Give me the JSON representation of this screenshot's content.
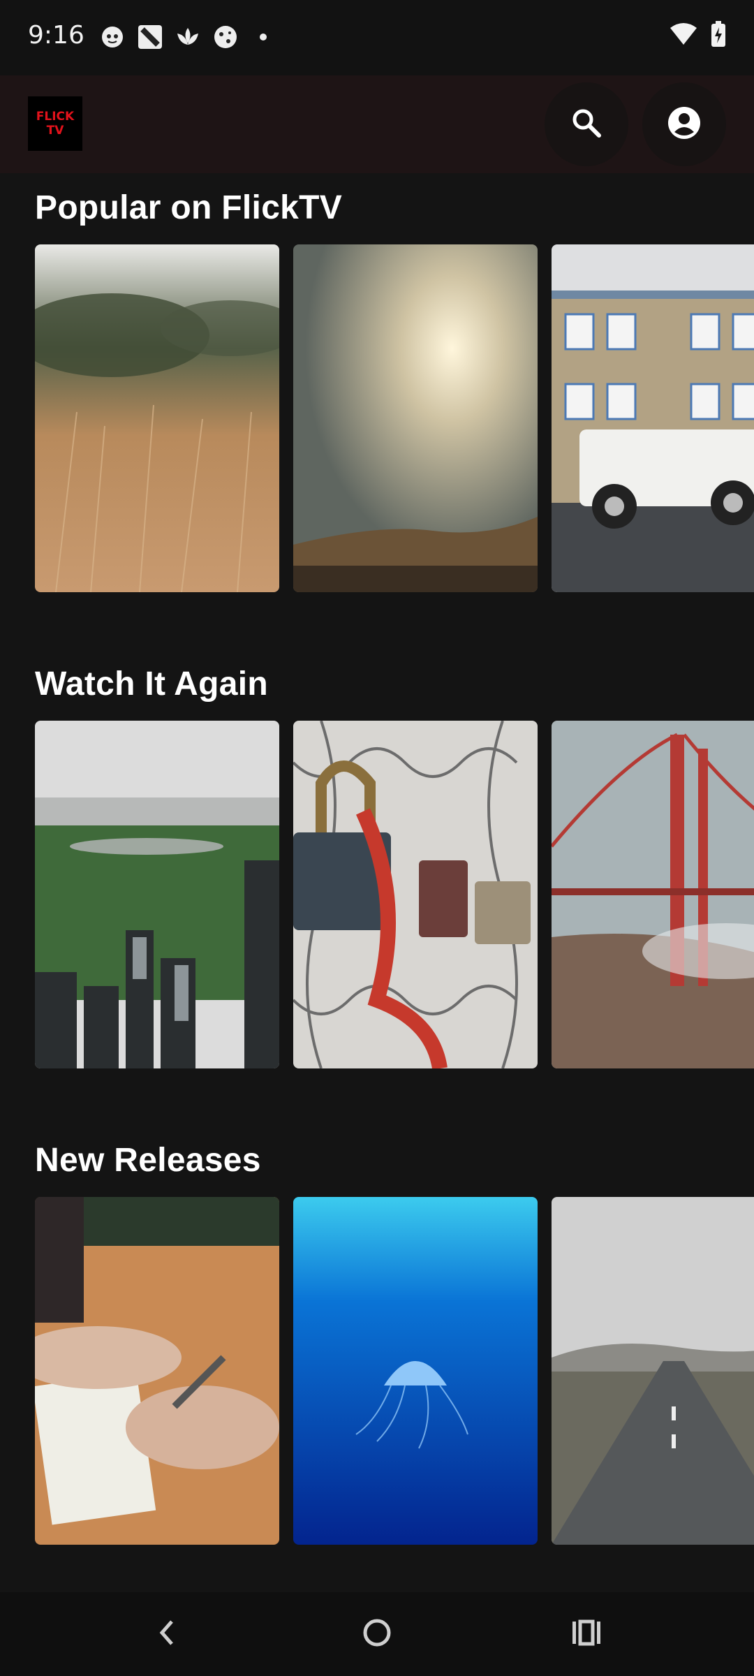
{
  "status_bar": {
    "time": "9:16",
    "notifications": [
      "cat-face-icon",
      "word-app-icon",
      "lotus-icon",
      "wordle-icon",
      "dot-icon"
    ],
    "system_icons": [
      "wifi-icon",
      "battery-charging-icon"
    ]
  },
  "header": {
    "logo_line1": "FLICK",
    "logo_line2": "TV",
    "logo_color": "#e3121b",
    "search_icon": "search-icon",
    "profile_icon": "account-circle-icon"
  },
  "sections": [
    {
      "title": "Popular on FlickTV",
      "posters": [
        "dry-grass-field",
        "sunlit-clouds-over-desert",
        "house-with-white-suv"
      ]
    },
    {
      "title": "Watch It Again",
      "posters": [
        "city-skyline-with-park",
        "padlocks-on-fence",
        "red-suspension-bridge"
      ]
    },
    {
      "title": "New Releases",
      "posters": [
        "hands-writing-in-notebook",
        "jellyfish-in-blue-water",
        "empty-road-through-landscape"
      ]
    }
  ],
  "nav_bar": {
    "back_icon": "back-icon",
    "home_icon": "home-icon",
    "recents_icon": "recents-icon"
  }
}
